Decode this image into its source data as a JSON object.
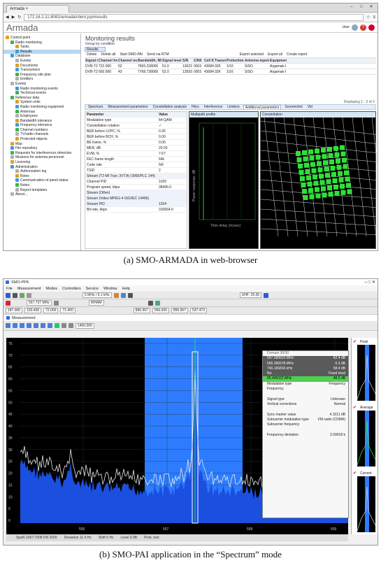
{
  "panel_a": {
    "tab_title": "Armada",
    "url": "172.16.2.11:8082/armada/client.jsp#results",
    "brand": "Armada",
    "user": "User",
    "tree": [
      {
        "label": "Control point",
        "lvl": 0
      },
      {
        "label": "Radio monitoring",
        "lvl": 1
      },
      {
        "label": "Tasks",
        "lvl": 2
      },
      {
        "label": "Results",
        "lvl": 2,
        "selected": true
      },
      {
        "label": "Database",
        "lvl": 1
      },
      {
        "label": "Events",
        "lvl": 2
      },
      {
        "label": "Documents",
        "lvl": 2
      },
      {
        "label": "Transceivers",
        "lvl": 2
      },
      {
        "label": "Frequency-site plan",
        "lvl": 2
      },
      {
        "label": "Emitters",
        "lvl": 2
      },
      {
        "label": "Events",
        "lvl": 1
      },
      {
        "label": "Radio monitoring events",
        "lvl": 2
      },
      {
        "label": "Technical events",
        "lvl": 2
      },
      {
        "label": "Reference data",
        "lvl": 1
      },
      {
        "label": "System units",
        "lvl": 2
      },
      {
        "label": "Radio monitoring equipment",
        "lvl": 2
      },
      {
        "label": "Antennas",
        "lvl": 2
      },
      {
        "label": "Employees",
        "lvl": 2
      },
      {
        "label": "Bandwidth tolerance",
        "lvl": 2
      },
      {
        "label": "Frequency tolerance",
        "lvl": 2
      },
      {
        "label": "Channel numbers",
        "lvl": 2
      },
      {
        "label": "TV/radio channels",
        "lvl": 2
      },
      {
        "label": "Protected objects",
        "lvl": 2
      },
      {
        "label": "Map",
        "lvl": 1
      },
      {
        "label": "File repository",
        "lvl": 1
      },
      {
        "label": "Requests for interferences detection",
        "lvl": 1
      },
      {
        "label": "Missions for antenna personnel",
        "lvl": 1
      },
      {
        "label": "Licensing",
        "lvl": 1
      },
      {
        "label": "Administration",
        "lvl": 1
      },
      {
        "label": "Authorization log",
        "lvl": 2
      },
      {
        "label": "Roles",
        "lvl": 2
      },
      {
        "label": "Communication of panel status",
        "lvl": 2
      },
      {
        "label": "Notes",
        "lvl": 2
      },
      {
        "label": "Report templates",
        "lvl": 2
      },
      {
        "label": "About...",
        "lvl": 1
      }
    ],
    "main_title": "Monitoring results",
    "group_label": "Group by condition",
    "results_tab": "Results",
    "toolbar": [
      "Delete",
      "Delete all",
      "Start SMO-PAI",
      "Send via RTM",
      "Export selected",
      "Export all",
      "Create report"
    ],
    "table_headers": [
      "Signal type",
      "Channel frequency, MHz",
      "Channel number",
      "Bandwidth, MHz",
      "Signal level, dBµV",
      "S/N",
      "C/N0",
      "Cell ID",
      "Transmit mode",
      "Protection interval",
      "Antenna topology mode",
      "Equipment"
    ],
    "table_rows": [
      [
        "DVB-T2",
        "722.000",
        "52",
        "7665.238000",
        "51.0",
        "13622",
        "0003",
        "43084",
        "32K",
        "1/16",
        "SISO",
        "Argamak-I"
      ],
      [
        "DVB-T2",
        "650.000",
        "43",
        "7768.738000",
        "52.0",
        "13593",
        "0003",
        "43084",
        "32K",
        "1/16",
        "SISO",
        "Argamak-I"
      ]
    ],
    "pager": "Displaying 1 - 2 of 2",
    "ptabs": [
      "Spectrum",
      "Measurement parameters",
      "Constellation analysis",
      "Files",
      "Interference",
      "Limiters",
      "Additional parameters",
      "Screenshot",
      "Vid"
    ],
    "param_header": [
      "Parameter",
      "Value"
    ],
    "params": [
      [
        "Modulation type",
        "64-QAM"
      ],
      [
        "Constellation rotation",
        ""
      ],
      [
        "BER before LDPC, %",
        "0.26"
      ],
      [
        "BER before BCH, %",
        "0.00"
      ],
      [
        "BE frame, %",
        "0.00"
      ],
      [
        "MER, dB",
        "29.03"
      ],
      [
        "EVM, %",
        "7.67"
      ],
      [
        "FEC frame length",
        "64k"
      ],
      [
        "Code rate",
        "5/6"
      ],
      [
        "TSID",
        "2"
      ],
      [
        "Stream (T2-MI Tran: 3VT/A | 0000/PLC 144)",
        ""
      ],
      [
        "Channel PID",
        "1020"
      ],
      [
        "Program speed, kbps",
        "38496.0"
      ],
      [
        "Stream (Other)",
        ""
      ],
      [
        "Stream (Video MPEG-4 ISO/IEC 14496)",
        ""
      ],
      [
        "Stream PID",
        "1024"
      ],
      [
        "Bit rate, kbps",
        "310664.0"
      ]
    ],
    "multipath_title": "Multipath profile",
    "multipath_ylabel": "Power response, dB",
    "multipath_xlabel": "Time delay (mcsec)",
    "constellation_title": "Constellation"
  },
  "caption_a": "(a) SMO-ARMADA in web-browser",
  "panel_b": {
    "title": "SMO-PPK",
    "menu": [
      "File",
      "Measurement",
      "Modes",
      "Controllers",
      "Service",
      "Window",
      "Help"
    ],
    "freq_center": "557.737 MHz",
    "span": "5 MHz / 6.1 kHz",
    "uhf": "UHF: 25.00",
    "mode": "WHAM",
    "markers": [
      "187.000",
      "193.400",
      "72.000",
      "71.400",
      "896.967",
      "556.000",
      "896.967",
      "537.473"
    ],
    "sub_title": "Measurement",
    "zoom_value": "1400.000",
    "y_ticks": [
      "75",
      "70",
      "65",
      "60",
      "55",
      "50",
      "45",
      "40",
      "35",
      "30",
      "25",
      "20",
      "15",
      "10",
      "5",
      "0"
    ],
    "x_ticks": [
      "556",
      "557",
      "558",
      "559"
    ],
    "context": {
      "header": "Domain 30/30",
      "items": [
        [
          "557.289623 MHz",
          "62.4 dB"
        ],
        [
          "556.396578 MHz",
          "6.3 dB"
        ],
        [
          "740.166816 kHz",
          "58.4 dB"
        ],
        [
          "No",
          "Fixed level"
        ],
        [
          "05.445322 MHz",
          "48.0 dB"
        ],
        [
          "Modulation type",
          "Frequency"
        ],
        [
          "Frequency",
          ""
        ],
        [
          "",
          ""
        ],
        [
          "Signal type",
          "Unknown"
        ],
        [
          "Vertical corrections",
          "Normal"
        ],
        [
          "",
          ""
        ],
        [
          "Sync marker value",
          "4.1011 dB"
        ],
        [
          "Subcarrier modulation type",
          "FM radio (CDMA)"
        ],
        [
          "Subcarrier frequency",
          ""
        ],
        [
          "",
          ""
        ],
        [
          "Frequency deviation",
          "3.59018 k"
        ]
      ]
    },
    "status": [
      "SpaN 1067:7008  DN 2000",
      "Deviation 11.4 Hz",
      "Shift 6 Hz",
      "Level 0.0B",
      "Prob. test"
    ],
    "side_labels": [
      "Peak",
      "Average",
      "Current"
    ]
  },
  "caption_b": "(b) SMO-PAI application in the “Spectrum” mode",
  "colors": {
    "accent": "#1e6ed8",
    "spectrum": "#1b4fe0",
    "highlight": "#2d7cff",
    "green": "#30e03a"
  }
}
